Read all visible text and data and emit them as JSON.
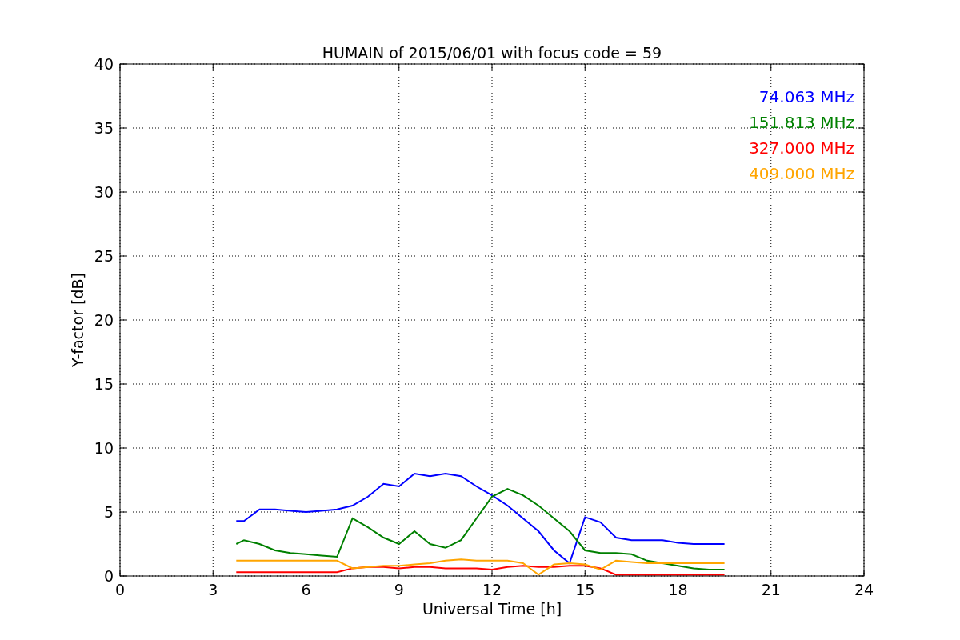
{
  "chart_data": {
    "type": "line",
    "title": "HUMAIN of 2015/06/01 with focus code = 59",
    "xlabel": "Universal Time [h]",
    "ylabel": "Y-factor [dB]",
    "x": [
      3.75,
      4,
      4.5,
      5,
      5.5,
      6,
      6.5,
      7,
      7.5,
      8,
      8.5,
      9,
      9.5,
      10,
      10.5,
      11,
      11.5,
      12,
      12.5,
      13,
      13.5,
      14,
      14.5,
      15,
      15.5,
      16,
      16.5,
      17,
      17.5,
      18,
      18.5,
      19,
      19.5
    ],
    "series": [
      {
        "name": "74.063 MHz",
        "color": "#0000ff",
        "values": [
          4.3,
          4.3,
          5.2,
          5.2,
          5.1,
          5.0,
          5.1,
          5.2,
          5.5,
          6.2,
          7.2,
          7.0,
          8.0,
          7.8,
          8.0,
          7.8,
          7.0,
          6.3,
          5.5,
          4.5,
          3.5,
          2.0,
          1.0,
          4.6,
          4.2,
          3.0,
          2.8,
          2.8,
          2.8,
          2.6,
          2.5,
          2.5,
          2.5
        ]
      },
      {
        "name": "151.813 MHz",
        "color": "#008000",
        "values": [
          2.5,
          2.8,
          2.5,
          2.0,
          1.8,
          1.7,
          1.6,
          1.5,
          4.5,
          3.8,
          3.0,
          2.5,
          3.5,
          2.5,
          2.2,
          2.8,
          4.5,
          6.2,
          6.8,
          6.3,
          5.5,
          4.5,
          3.5,
          2.0,
          1.8,
          1.8,
          1.7,
          1.2,
          1.0,
          0.8,
          0.6,
          0.5,
          0.5
        ]
      },
      {
        "name": "327.000 MHz",
        "color": "#ff0000",
        "values": [
          0.3,
          0.3,
          0.3,
          0.3,
          0.3,
          0.3,
          0.3,
          0.3,
          0.6,
          0.7,
          0.7,
          0.6,
          0.7,
          0.7,
          0.6,
          0.6,
          0.6,
          0.5,
          0.7,
          0.8,
          0.7,
          0.7,
          0.8,
          0.8,
          0.6,
          0.1,
          0.1,
          0.1,
          0.1,
          0.1,
          0.1,
          0.1,
          0.1
        ]
      },
      {
        "name": "409.000 MHz",
        "color": "#ffa500",
        "values": [
          1.2,
          1.2,
          1.2,
          1.2,
          1.2,
          1.2,
          1.2,
          1.2,
          0.6,
          0.7,
          0.8,
          0.8,
          0.9,
          1.0,
          1.2,
          1.3,
          1.2,
          1.2,
          1.2,
          1.0,
          0.1,
          0.9,
          1.0,
          0.9,
          0.5,
          1.2,
          1.1,
          1.0,
          1.0,
          1.0,
          1.0,
          1.0,
          1.0
        ]
      }
    ],
    "grid": true,
    "xlim": [
      0,
      24
    ],
    "ylim": [
      0,
      40
    ],
    "xticks": [
      0,
      3,
      6,
      9,
      12,
      15,
      18,
      21,
      24
    ],
    "yticks": [
      0,
      5,
      10,
      15,
      20,
      25,
      30,
      35,
      40
    ]
  }
}
